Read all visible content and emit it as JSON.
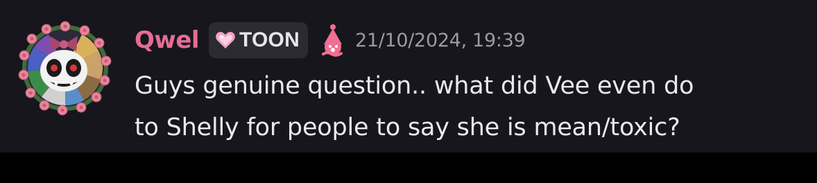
{
  "message": {
    "author": {
      "name": "Qwel",
      "name_color": "#e36d93",
      "avatar_icon": "clown-doll-flower-wreath-avatar"
    },
    "tag": {
      "icon": "pink-heart-icon",
      "label": "TOON"
    },
    "role_icon": "pink-clown-hat-icon",
    "timestamp": "21/10/2024, 19:39",
    "content_lines": [
      "Guys genuine question.. what did Vee even do",
      "to Shelly for people to say she is mean/toxic?"
    ]
  },
  "colors": {
    "message_background": "#16161c",
    "page_background": "#000000",
    "text": "#eaeaee",
    "muted_text": "#9a9aa4",
    "tag_background": "#2b2b33"
  }
}
